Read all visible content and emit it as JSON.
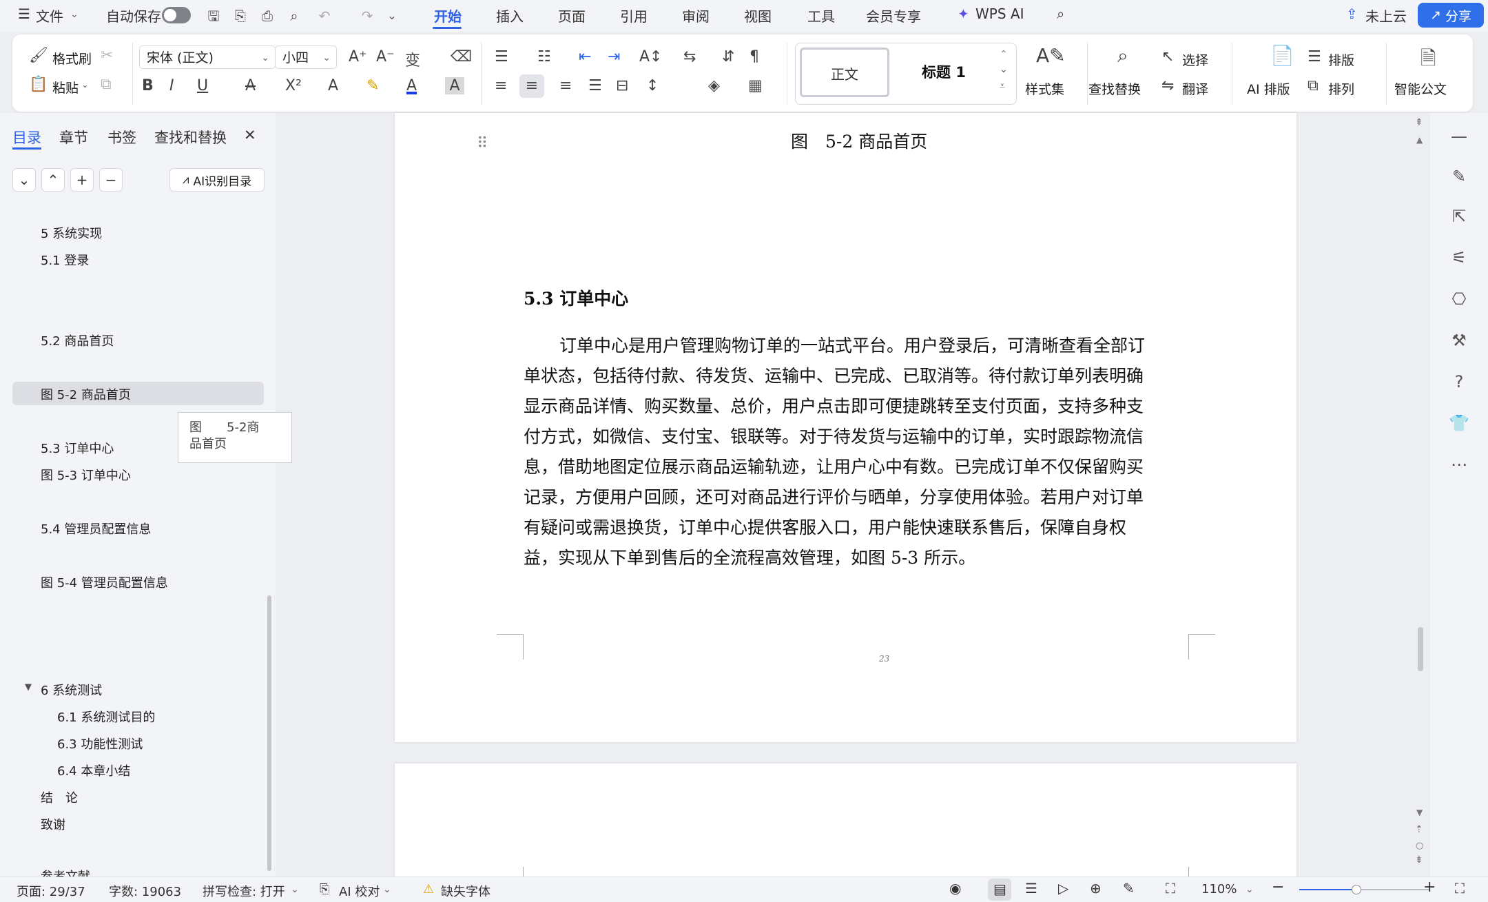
{
  "menubar": {
    "file": "文件",
    "autosave": "自动保存",
    "tabs": [
      "开始",
      "插入",
      "页面",
      "引用",
      "审阅",
      "视图",
      "工具",
      "会员专享"
    ],
    "wps_ai": "WPS AI",
    "cloud": "未上云",
    "share": "分享"
  },
  "ribbon": {
    "format_painter": "格式刷",
    "paste": "粘贴",
    "font_name": "宋体 (正文)",
    "font_size": "小四",
    "style_normal": "正文",
    "style_heading": "标题 1",
    "style_set": "样式集",
    "find_replace": "查找替换",
    "select": "选择",
    "translate": "翻译",
    "ai_layout": "AI 排版",
    "layout": "排版",
    "arrange": "排列",
    "smart_doc": "智能公文"
  },
  "panel": {
    "tabs": [
      "目录",
      "章节",
      "书签",
      "查找和替换"
    ],
    "ai_toc": "AI识别目录",
    "toc": [
      "5 系统实现",
      "5.1 登录",
      "5.2 商品首页",
      "图 5-2 商品首页",
      "5.3 订单中心",
      "图 5-3 订单中心",
      "5.4 管理员配置信息",
      "图 5-4 管理员配置信息",
      "6 系统测试",
      "6.1 系统测试目的",
      "6.3 功能性测试",
      "6.4 本章小结",
      "结　论",
      "致谢",
      "参考文献"
    ],
    "tooltip_line1": "图　　5-2商",
    "tooltip_line2": "品首页"
  },
  "document": {
    "figure_caption": "图　5-2 商品首页",
    "section_heading": "5.3 订单中心",
    "paragraph_lines": [
      "订单中心是用户管理购物订单的一站式平台。用户登录后，可清晰查看全部订",
      "单状态，包括待付款、待发货、运输中、已完成、已取消等。待付款订单列表明确",
      "显示商品详情、购买数量、总价，用户点击即可便捷跳转至支付页面，支持多种支",
      "付方式，如微信、支付宝、银联等。对于待发货与运输中的订单，实时跟踪物流信",
      "息，借助地图定位展示商品运输轨迹，让用户心中有数。已完成订单不仅保留购买",
      "记录，方便用户回顾，还可对商品进行评价与晒单，分享使用体验。若用户对订单",
      "有疑问或需退换货，订单中心提供客服入口，用户能快速联系售后，保障自身权",
      "益，实现从下单到售后的全流程高效管理，如图 5-3 所示。"
    ],
    "page_number": "23"
  },
  "status": {
    "page": "页面: 29/37",
    "words": "字数: 19063",
    "spellcheck": "拼写检查: 打开",
    "ai_check": "AI 校对",
    "missing_font": "缺失字体",
    "zoom": "110%"
  },
  "colors": {
    "accent": "#2f63e6",
    "share_bg": "#2f6fe9"
  }
}
